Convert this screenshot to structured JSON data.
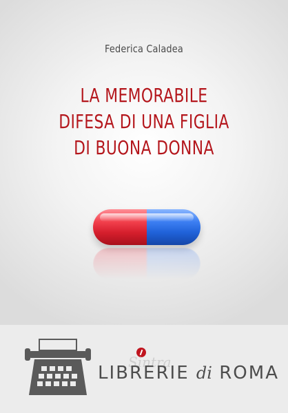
{
  "cover": {
    "author": "Federica Caladea",
    "title_lines": [
      "LA MEMORABILE",
      "DIFESA DI UNA FIGLIA",
      "DI BUONA DONNA"
    ]
  },
  "footer": {
    "brand_part1": "LIBRERIE",
    "brand_part2": "di",
    "brand_part3": "ROMA",
    "brand_script": "Sintra"
  },
  "colors": {
    "title": "#b4161c",
    "pill_red": "#d61f2d",
    "pill_blue": "#2062d9",
    "brand_accent": "#c0151f"
  },
  "icons": [
    "typewriter-icon",
    "pill-icon",
    "brand-pen-icon"
  ]
}
